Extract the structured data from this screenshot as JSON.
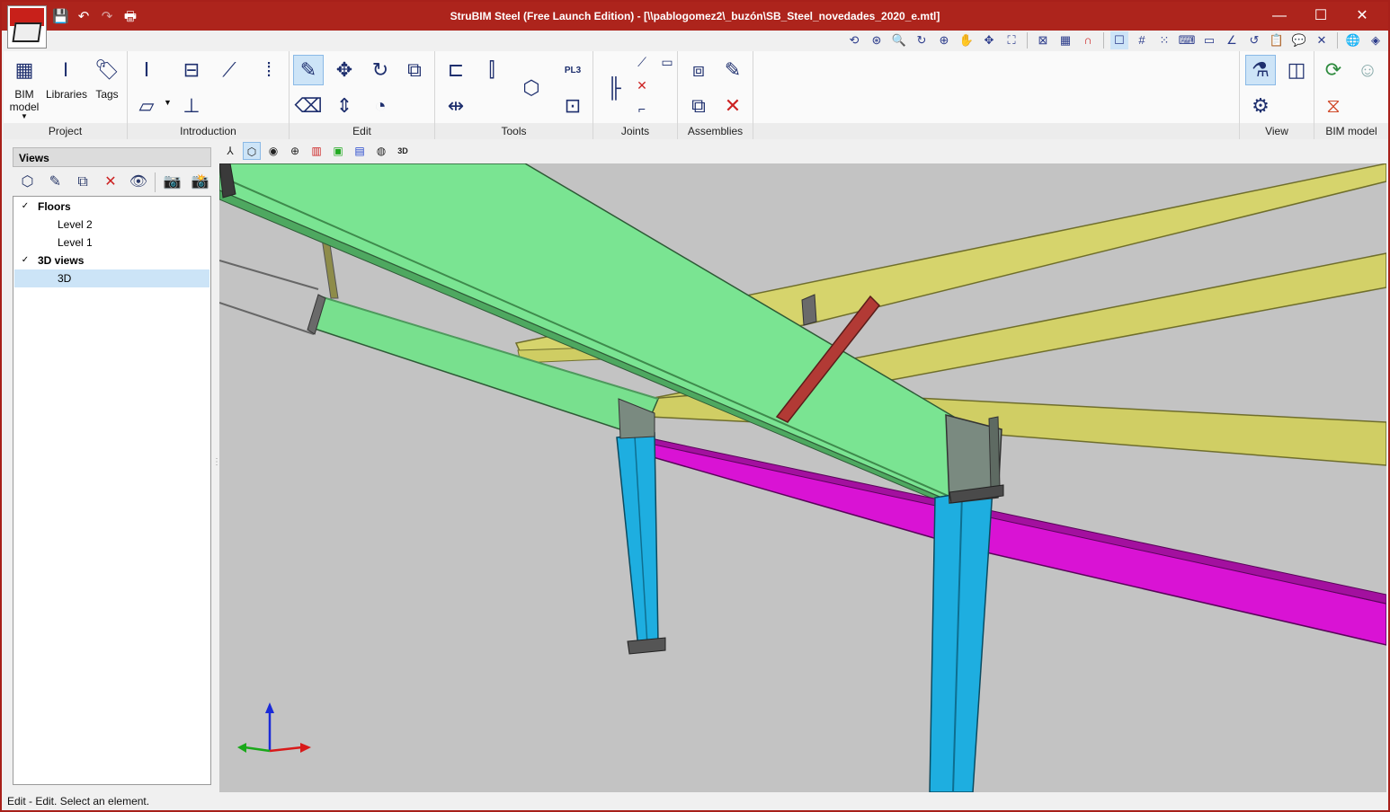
{
  "window": {
    "title": "StruBIM Steel (Free Launch Edition) - [\\\\pablogomez2\\_buzón\\SB_Steel_novedades_2020_e.mtl]",
    "minimize": "—",
    "maximize": "☐",
    "close": "✕"
  },
  "quick_access": {
    "save": "💾",
    "undo": "↶",
    "redo": "↷",
    "print": "🖶"
  },
  "ribbon": {
    "groups": {
      "project": "Project",
      "introduction": "Introduction",
      "edit": "Edit",
      "tools": "Tools",
      "joints": "Joints",
      "assemblies": "Assemblies",
      "view": "View",
      "bim_model": "BIM model"
    },
    "buttons": {
      "bim_model_line1": "BIM",
      "bim_model_line2": "model",
      "libraries": "Libraries",
      "tags": "Tags"
    },
    "tool_glyphs": {
      "pl3": "PL3"
    }
  },
  "views_panel": {
    "header": "Views",
    "tree": {
      "floors": "Floors",
      "level2": "Level 2",
      "level1": "Level 1",
      "views3d": "3D views",
      "view3d": "3D"
    }
  },
  "viewport_toolbar": {
    "three_d": "3D"
  },
  "status": {
    "text": "Edit - Edit. Select an element."
  },
  "colors": {
    "title_bar": "#ad241c",
    "beam_green": "#78e08e",
    "beam_yellow": "#d6d46c",
    "beam_magenta": "#d913d4",
    "column_blue": "#1eaee0",
    "brace_red": "#b23a35",
    "viewport_bg": "#c3c3c3",
    "selection": "#cce4f7"
  }
}
